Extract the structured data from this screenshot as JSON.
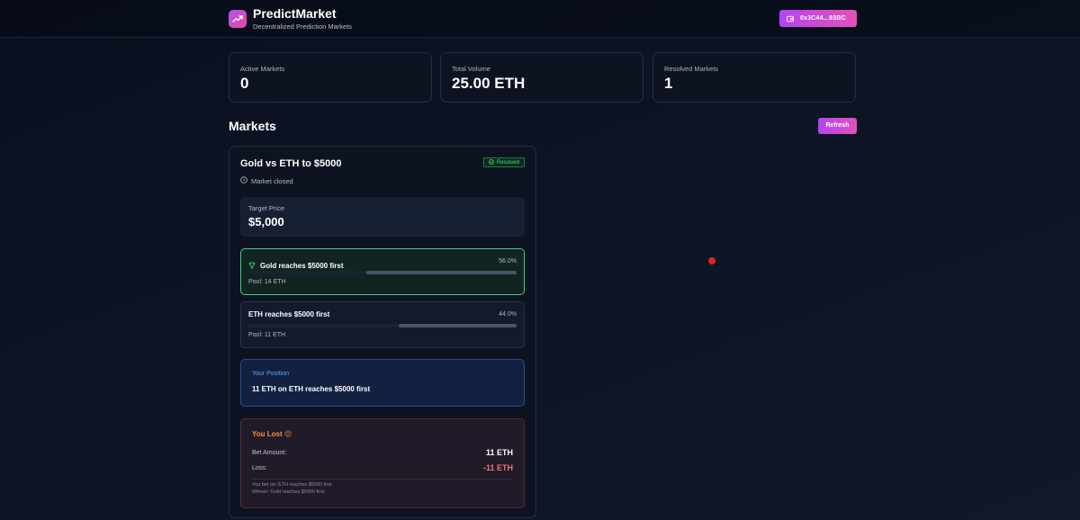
{
  "header": {
    "title": "PredictMarket",
    "subtitle": "Decentralized Prediction Markets",
    "wallet_label": "0x3C44...93BC",
    "logo_icon": "trending-up-icon",
    "wallet_icon": "wallet-icon",
    "accent_gradient": [
      "#b245f0",
      "#e351b9"
    ]
  },
  "stats": [
    {
      "label": "Active Markets",
      "value": "0"
    },
    {
      "label": "Total Volume",
      "value": "25.00 ETH"
    },
    {
      "label": "Resolved Markets",
      "value": "1"
    }
  ],
  "markets_section": {
    "title": "Markets",
    "refresh_label": "Refresh"
  },
  "market": {
    "title": "Gold vs ETH to $5000",
    "status_badge": "Resolved",
    "status_color": "#4ade80",
    "closed_text": "Market closed",
    "target_label": "Target Price",
    "target_value": "$5,000",
    "outcomes": [
      {
        "name": "Gold reaches $5000 first",
        "percent": "56.0%",
        "share": 0.56,
        "pool": "Pool: 14 ETH",
        "winner": true,
        "icon": "trophy-icon"
      },
      {
        "name": "ETH reaches $5000 first",
        "percent": "44.0%",
        "share": 0.44,
        "pool": "Pool: 11 ETH",
        "winner": false
      }
    ],
    "position": {
      "label": "Your Position",
      "text": "11 ETH on ETH reaches $5000 first"
    },
    "result": {
      "title": "You Lost 😔",
      "bet_label": "Bet Amount:",
      "bet_value": "11 ETH",
      "loss_label": "Loss:",
      "loss_value": "-11 ETH",
      "note_bet": "You bet on: ETH reaches $5000 first",
      "note_winner": "Winner: Gold reaches $5000 first"
    }
  }
}
